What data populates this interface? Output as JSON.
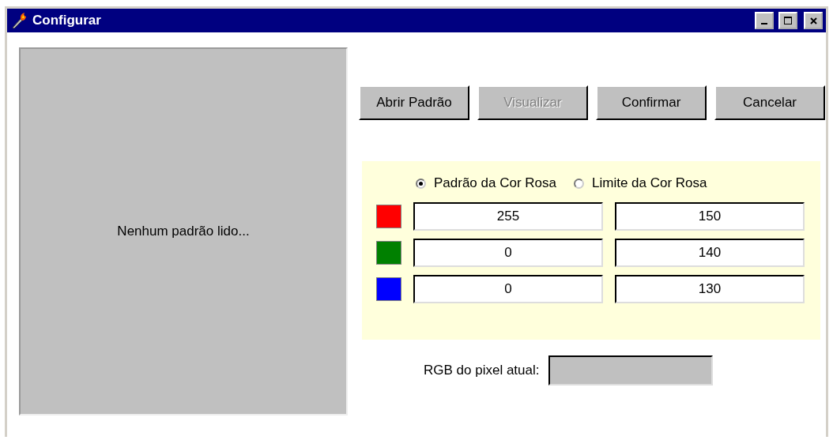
{
  "window": {
    "title": "Configurar"
  },
  "preview": {
    "message": "Nenhum padrão lido..."
  },
  "buttons": [
    {
      "label": "Abrir Padrão",
      "disabled": false
    },
    {
      "label": "Visualizar",
      "disabled": true
    },
    {
      "label": "Confirmar",
      "disabled": false
    },
    {
      "label": "Cancelar",
      "disabled": false
    }
  ],
  "modes": [
    {
      "label": "Padrão da Cor Rosa",
      "selected": true
    },
    {
      "label": "Limite da Cor Rosa",
      "selected": false
    }
  ],
  "channels": [
    {
      "color": "#ff0000",
      "standard": "255",
      "limit": "150"
    },
    {
      "color": "#008000",
      "standard": "0",
      "limit": "140"
    },
    {
      "color": "#0000ff",
      "standard": "0",
      "limit": "130"
    }
  ],
  "pixel": {
    "label": "RGB do pixel atual:"
  }
}
